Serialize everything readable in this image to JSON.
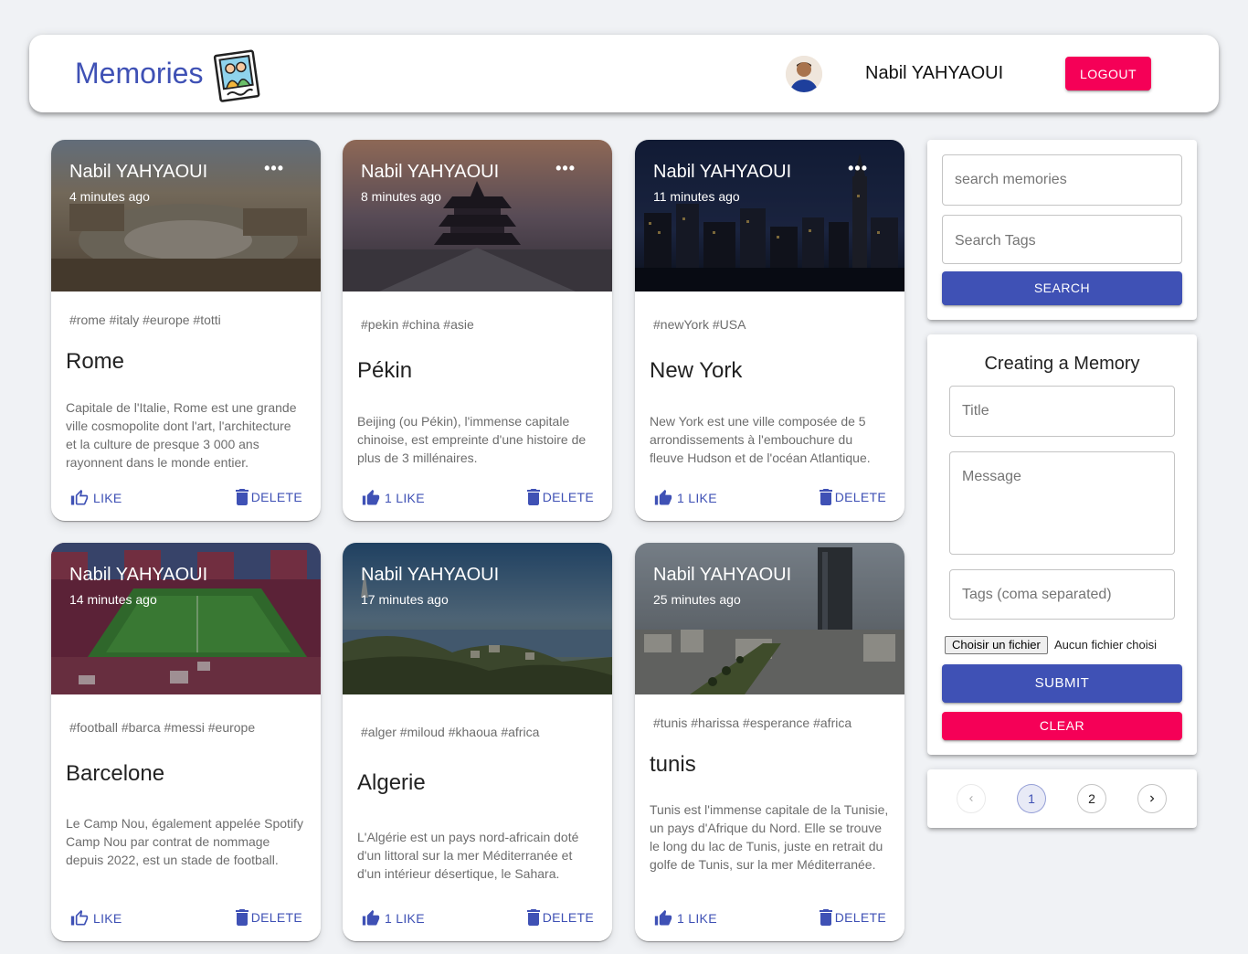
{
  "header": {
    "brand": "Memories",
    "user_name": "Nabil YAHYAOUI",
    "logout_label": "LOGOUT"
  },
  "posts": [
    {
      "author": "Nabil YAHYAOUI",
      "time": "4 minutes ago",
      "tags": "#rome #italy #europe #totti",
      "title": "Rome",
      "message": "Capitale de l'Italie, Rome est une grande ville cosmopolite dont l'art, l'architecture et la culture de presque 3 000 ans rayonnent dans le monde entier.",
      "like_label": "LIKE",
      "delete_label": "DELETE"
    },
    {
      "author": "Nabil YAHYAOUI",
      "time": "8 minutes ago",
      "tags": "#pekin #china #asie",
      "title": "Pékin",
      "message": "Beijing (ou Pékin), l'immense capitale chinoise, est empreinte d'une histoire de plus de 3 millénaires.",
      "like_label": "1 LIKE",
      "delete_label": "DELETE"
    },
    {
      "author": "Nabil YAHYAOUI",
      "time": "11 minutes ago",
      "tags": "#newYork #USA",
      "title": "New York",
      "message": "New York est une ville composée de 5 arrondissements à l'embouchure du fleuve Hudson et de l'océan Atlantique.",
      "like_label": "1 LIKE",
      "delete_label": "DELETE"
    },
    {
      "author": "Nabil YAHYAOUI",
      "time": "14 minutes ago",
      "tags": "#football #barca #messi #europe",
      "title": "Barcelone",
      "message": "Le Camp Nou, également appelée Spotify Camp Nou par contrat de nommage depuis 2022, est un stade de football.",
      "like_label": "LIKE",
      "delete_label": "DELETE"
    },
    {
      "author": "Nabil YAHYAOUI",
      "time": "17 minutes ago",
      "tags": "#alger #miloud #khaoua #africa",
      "title": "Algerie",
      "message": "L'Algérie est un pays nord-africain doté d'un littoral sur la mer Méditerranée et d'un intérieur désertique, le Sahara.",
      "like_label": "1 LIKE",
      "delete_label": "DELETE"
    },
    {
      "author": "Nabil YAHYAOUI",
      "time": "25 minutes ago",
      "tags": "#tunis #harissa #esperance #africa",
      "title": "tunis",
      "message": "Tunis est l'immense capitale de la Tunisie, un pays d'Afrique du Nord. Elle se trouve le long du lac de Tunis, juste en retrait du golfe de Tunis, sur la mer Méditerranée.",
      "like_label": "1 LIKE",
      "delete_label": "DELETE"
    }
  ],
  "search": {
    "memories_placeholder": "search memories",
    "tags_placeholder": "Search Tags",
    "button_label": "SEARCH"
  },
  "form": {
    "heading": "Creating a Memory",
    "title_placeholder": "Title",
    "message_placeholder": "Message",
    "tags_placeholder": "Tags (coma separated)",
    "file_button": "Choisir un fichier",
    "file_status": "Aucun fichier choisi",
    "submit_label": "SUBMIT",
    "clear_label": "CLEAR"
  },
  "pagination": {
    "pages": [
      "1",
      "2"
    ],
    "current": "1"
  },
  "colors": {
    "primary": "#3f51b5",
    "secondary": "#f50057",
    "background": "#f0f2f5"
  }
}
